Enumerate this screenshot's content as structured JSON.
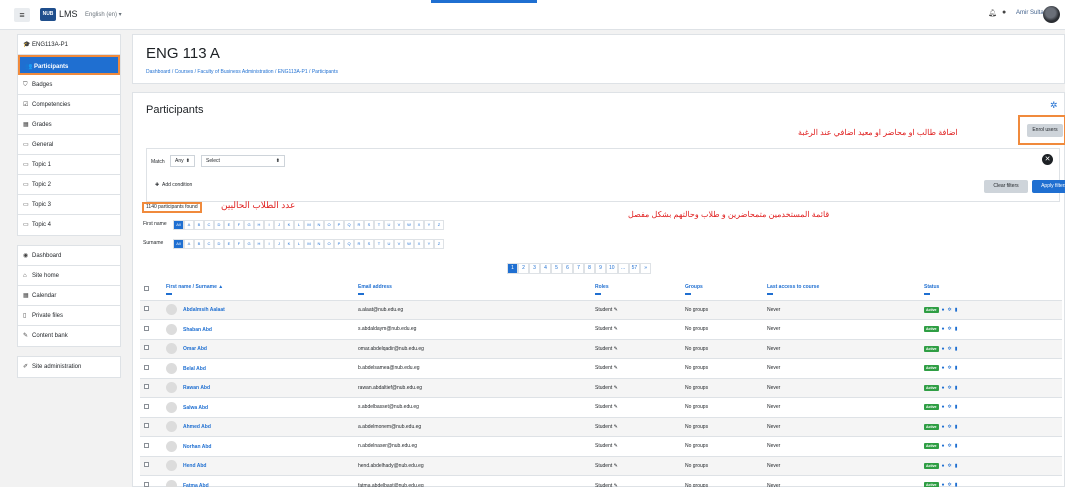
{
  "navbar": {
    "menu_icon": "hamburger-icon",
    "logo_text": "NUB",
    "site_name": "LMS",
    "language": "English (en) ▾",
    "user_name": "Amir Sultan"
  },
  "sidebar": {
    "course_items": [
      {
        "label": "ENG113A-P1",
        "icon": "graduation-cap-icon",
        "glyph": "🎓"
      },
      {
        "label": "Participants",
        "icon": "users-icon",
        "glyph": "👥",
        "active": true
      },
      {
        "label": "Badges",
        "icon": "badge-icon",
        "glyph": "⛉"
      },
      {
        "label": "Competencies",
        "icon": "check-square-icon",
        "glyph": "☑"
      },
      {
        "label": "Grades",
        "icon": "table-icon",
        "glyph": "▦"
      },
      {
        "label": "General",
        "icon": "folder-icon",
        "glyph": "▭"
      },
      {
        "label": "Topic 1",
        "icon": "folder-icon",
        "glyph": "▭"
      },
      {
        "label": "Topic 2",
        "icon": "folder-icon",
        "glyph": "▭"
      },
      {
        "label": "Topic 3",
        "icon": "folder-icon",
        "glyph": "▭"
      },
      {
        "label": "Topic 4",
        "icon": "folder-icon",
        "glyph": "▭"
      }
    ],
    "site_items": [
      {
        "label": "Dashboard",
        "icon": "dashboard-icon",
        "glyph": "◉"
      },
      {
        "label": "Site home",
        "icon": "home-icon",
        "glyph": "⌂"
      },
      {
        "label": "Calendar",
        "icon": "calendar-icon",
        "glyph": "▦"
      },
      {
        "label": "Private files",
        "icon": "file-icon",
        "glyph": "▯"
      },
      {
        "label": "Content bank",
        "icon": "pencil-icon",
        "glyph": "✎"
      }
    ],
    "admin_items": [
      {
        "label": "Site administration",
        "icon": "wrench-icon",
        "glyph": "✐"
      }
    ]
  },
  "header": {
    "title": "ENG 113 A",
    "breadcrumb": "Dashboard / Courses / Faculty of Business Administration / ENG113A-P1 / Participants"
  },
  "participants": {
    "title": "Participants",
    "enrol_button": "Enrol users",
    "annotation_enrol": "اضافة طالب او محاضر او معيد اضافي عند الرغبة",
    "annotation_found": "عدد الطلاب الحاليين",
    "annotation_list": "قائمة المستخدمين متمحاضرين و طلاب وحالتهم بشكل مفصل",
    "filter": {
      "match_label": "Match",
      "match_value": "Any",
      "select_value": "Select",
      "add_condition": "Add condition",
      "clear_filters": "Clear filters",
      "apply_filters": "Apply filters"
    },
    "found_text": "1140 participants found",
    "first_name_label": "First name",
    "surname_label": "Surname",
    "letters": [
      "All",
      "A",
      "B",
      "C",
      "D",
      "E",
      "F",
      "G",
      "H",
      "I",
      "J",
      "K",
      "L",
      "M",
      "N",
      "O",
      "P",
      "Q",
      "R",
      "S",
      "T",
      "U",
      "V",
      "W",
      "X",
      "Y",
      "Z"
    ],
    "pages": [
      "1",
      "2",
      "3",
      "4",
      "5",
      "6",
      "7",
      "8",
      "9",
      "10",
      "...",
      "57",
      "»"
    ],
    "columns": {
      "name": "First name / Surname ▲",
      "email": "Email address",
      "roles": "Roles",
      "groups": "Groups",
      "last_access": "Last access to course",
      "status": "Status"
    },
    "status_badge": "Active",
    "rows": [
      {
        "name": "Abdalmsih Aalaat",
        "email": "a.alaat@nub.edu.eg",
        "role": "Student ✎",
        "groups": "No groups",
        "access": "Never"
      },
      {
        "name": "Shaban Abd",
        "email": "s.abdaldaym@nub.edu.eg",
        "role": "Student ✎",
        "groups": "No groups",
        "access": "Never"
      },
      {
        "name": "Omar Abd",
        "email": "omar.abdelqadir@nub.edu.eg",
        "role": "Student ✎",
        "groups": "No groups",
        "access": "Never"
      },
      {
        "name": "Belal Abd",
        "email": "b.abdelsamea@nub.edu.eg",
        "role": "Student ✎",
        "groups": "No groups",
        "access": "Never"
      },
      {
        "name": "Rawan Abd",
        "email": "rawan.abdaltief@nub.edu.eg",
        "role": "Student ✎",
        "groups": "No groups",
        "access": "Never"
      },
      {
        "name": "Salwa Abd",
        "email": "s.abdelbasset@nub.edu.eg",
        "role": "Student ✎",
        "groups": "No groups",
        "access": "Never"
      },
      {
        "name": "Ahmed Abd",
        "email": "a.abdelmonem@nub.edu.eg",
        "role": "Student ✎",
        "groups": "No groups",
        "access": "Never"
      },
      {
        "name": "Norhan Abd",
        "email": "n.abdelnaser@nub.edu.eg",
        "role": "Student ✎",
        "groups": "No groups",
        "access": "Never"
      },
      {
        "name": "Hend Abd",
        "email": "hend.abdelhady@nub.edu.eg",
        "role": "Student ✎",
        "groups": "No groups",
        "access": "Never"
      },
      {
        "name": "Fatma Abd",
        "email": "fatma.abdelbast@nub.edu.eg",
        "role": "Student ✎",
        "groups": "No groups",
        "access": "Never"
      }
    ]
  }
}
